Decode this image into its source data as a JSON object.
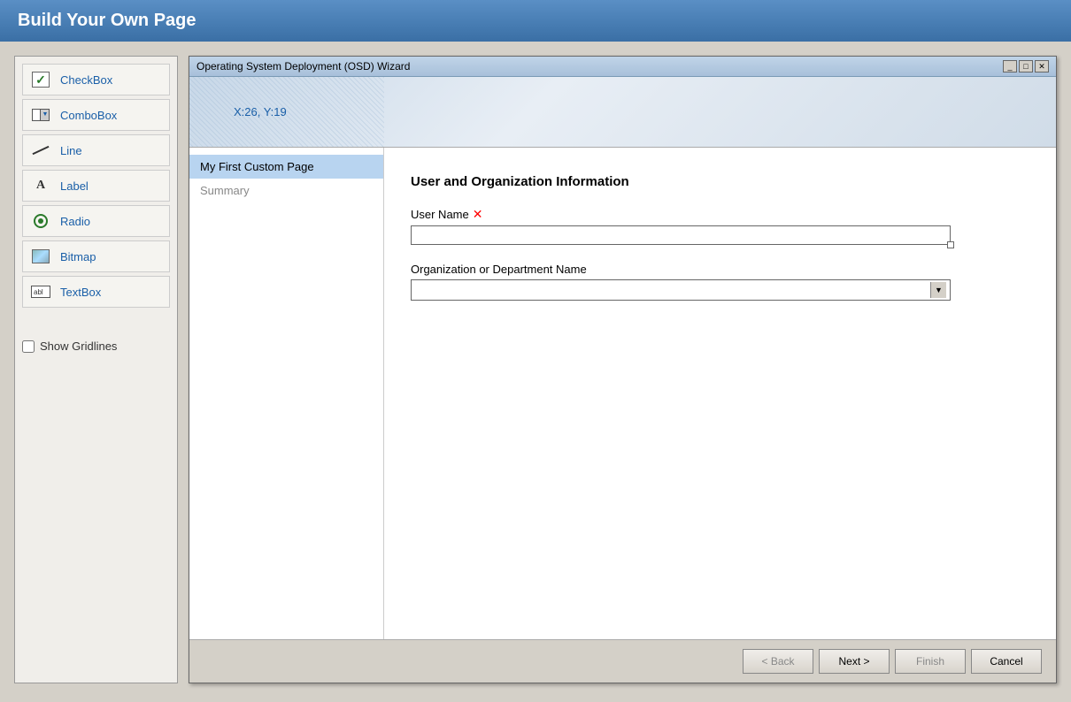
{
  "header": {
    "title": "Build Your Own Page"
  },
  "toolbox": {
    "items": [
      {
        "id": "checkbox",
        "label": "CheckBox",
        "icon": "checkbox-icon"
      },
      {
        "id": "combobox",
        "label": "ComboBox",
        "icon": "combobox-icon"
      },
      {
        "id": "line",
        "label": "Line",
        "icon": "line-icon"
      },
      {
        "id": "label",
        "label": "Label",
        "icon": "label-icon"
      },
      {
        "id": "radio",
        "label": "Radio",
        "icon": "radio-icon"
      },
      {
        "id": "bitmap",
        "label": "Bitmap",
        "icon": "bitmap-icon"
      },
      {
        "id": "textbox",
        "label": "TextBox",
        "icon": "textbox-icon"
      }
    ],
    "show_gridlines_label": "Show Gridlines"
  },
  "wizard": {
    "title": "Operating System Deployment (OSD) Wizard",
    "coords": "X:26, Y:19",
    "nav_items": [
      {
        "id": "custom-page",
        "label": "My First Custom Page",
        "active": true
      },
      {
        "id": "summary",
        "label": "Summary",
        "active": false
      }
    ],
    "section_title": "User and Organization Information",
    "fields": [
      {
        "id": "user-name",
        "label": "User Name",
        "type": "textbox",
        "required": true,
        "value": ""
      },
      {
        "id": "org-dept-name",
        "label": "Organization or Department Name",
        "type": "combobox",
        "required": false,
        "value": ""
      }
    ],
    "buttons": {
      "back": "< Back",
      "next": "Next >",
      "finish": "Finish",
      "cancel": "Cancel"
    }
  }
}
